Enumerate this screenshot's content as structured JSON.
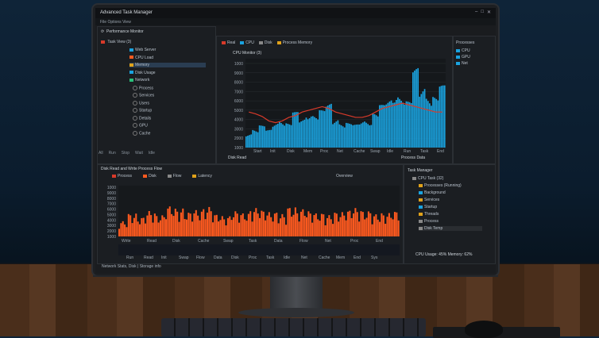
{
  "app": {
    "title": "Advanced Task Manager",
    "menu": "File  Options  View"
  },
  "window_controls": [
    "–",
    "□",
    "✕"
  ],
  "left_panel": {
    "toolbar": "Performance Monitor",
    "root": "Task View (3)",
    "items": [
      "Web Server",
      "CPU Load",
      "Memory",
      "Disk Usage",
      "Network",
      "Process",
      "Services",
      "Users",
      "Startup",
      "Details",
      "GPU",
      "Cache"
    ],
    "status": [
      "All",
      "Run",
      "Stop",
      "Wait",
      "Idle"
    ]
  },
  "top_chart": {
    "legend": [
      "Real",
      "CPU",
      "Disk",
      "Process Memory"
    ],
    "header": "CPU Monitor (3)",
    "y_ticks": [
      "1000",
      "9000",
      "8000",
      "7000",
      "6000",
      "5000",
      "4000",
      "3000",
      "2000",
      "1000"
    ],
    "x_ticks": [
      "Start",
      "Init",
      "Disk",
      "Mem",
      "Proc",
      "Net",
      "Cache",
      "Swap",
      "Idle",
      "Run",
      "Task",
      "End"
    ],
    "footer": "Disk Read",
    "footer_right": "Process Data"
  },
  "right_top": {
    "title": "Processes",
    "items": [
      "CPU",
      "GPU",
      "Net"
    ]
  },
  "bottom_panel": {
    "title": "Disk Read and Write Process Flow",
    "tabs": [
      "Process",
      "Disk",
      "Flow",
      "Latency"
    ],
    "header_right": "Overview",
    "y_ticks": [
      "1000",
      "9000",
      "8000",
      "7000",
      "6000",
      "5000",
      "4000",
      "3000",
      "2000",
      "1000"
    ],
    "x_ticks_top": [
      "Write",
      "Read",
      "Disk",
      "Cache",
      "Swap",
      "Task",
      "Data",
      "Flow",
      "Net",
      "Proc",
      "End"
    ],
    "x_ticks_bottom": [
      "Run",
      "Read",
      "Init",
      "Swap",
      "Flow",
      "Data",
      "Disk",
      "Proc",
      "Task",
      "Idle",
      "Net",
      "Cache",
      "Mem",
      "End",
      "Sys"
    ],
    "status": "Network Stats, Disk | Storage info"
  },
  "bottom_right": {
    "title": "Task Manager",
    "items": [
      "CPU Task (32)",
      "Processes (Running)",
      "Background",
      "Services",
      "Startup",
      "Threads",
      "Process",
      "Disk Temp"
    ],
    "selected": "Disk Temp",
    "status": "CPU Usage: 45% Memory: 62%"
  },
  "colors": {
    "cpu_blue": "#1aa3e0",
    "disk_orange": "#ff5a1f",
    "trend_red": "#d83a2a",
    "bg_panel": "#1b1e22"
  },
  "chart_data": [
    {
      "type": "area",
      "title": "CPU Monitor (3)",
      "series": [
        {
          "name": "CPU",
          "values": [
            18,
            22,
            25,
            20,
            30,
            35,
            28,
            40,
            33,
            45,
            38,
            42,
            50,
            36,
            30,
            28,
            26,
            32,
            35,
            40,
            48,
            55,
            70,
            60,
            52,
            90,
            75,
            65,
            58,
            70
          ]
        },
        {
          "name": "Real",
          "values": [
            40,
            38,
            35,
            30,
            28,
            30,
            34,
            36,
            40,
            42,
            44,
            46,
            44,
            40,
            38,
            36,
            34,
            34,
            36,
            40,
            44,
            46,
            48,
            50,
            48,
            46,
            44,
            42,
            40,
            40
          ]
        }
      ],
      "ylim": [
        0,
        100
      ]
    },
    {
      "type": "area",
      "title": "Disk Read and Write Process Flow",
      "series": [
        {
          "name": "Disk",
          "values": [
            30,
            45,
            38,
            50,
            42,
            60,
            55,
            48,
            52,
            58,
            44,
            40,
            50,
            46,
            56,
            52,
            48,
            44,
            58,
            54,
            50,
            46,
            42,
            48,
            52,
            56,
            50,
            44,
            46,
            50
          ]
        }
      ],
      "ylim": [
        0,
        100
      ]
    }
  ]
}
